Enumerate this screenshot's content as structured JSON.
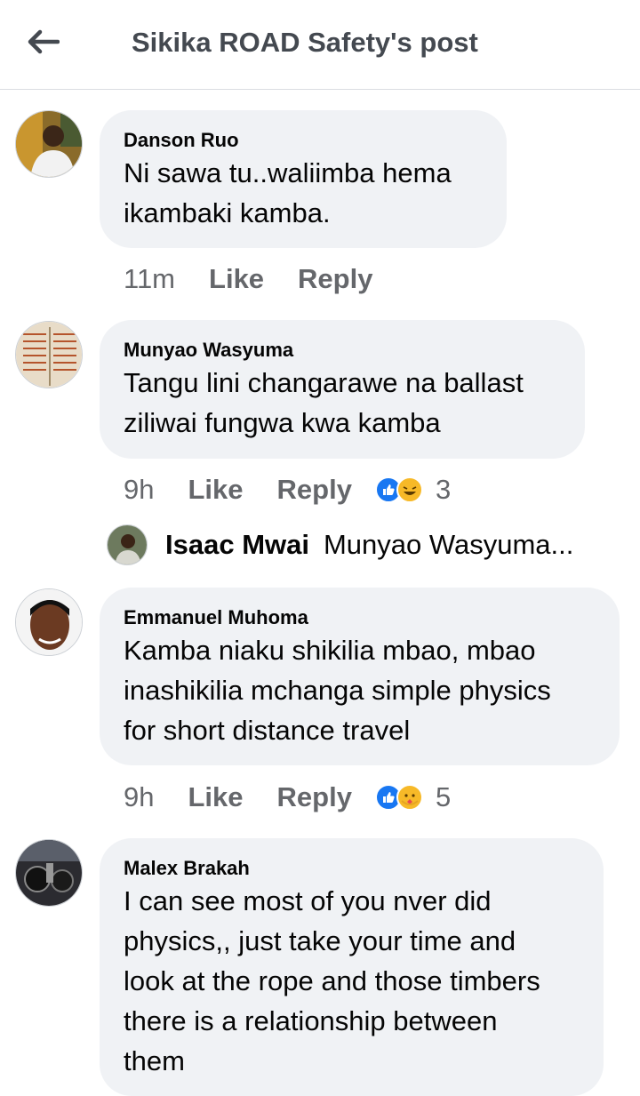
{
  "header": {
    "title": "Sikika ROAD Safety's post",
    "back_icon": "arrow-left-icon"
  },
  "comments": [
    {
      "author": "Danson Ruo",
      "lines": [
        "Ni sawa tu..waliimba hema",
        "ikambaki kamba."
      ],
      "time": "11m",
      "like": "Like",
      "reply": "Reply",
      "reaction_count": ""
    },
    {
      "author": "Munyao Wasyuma",
      "lines": [
        "Tangu lini changarawe na ballast",
        "ziliwai fungwa kwa kamba"
      ],
      "time": "9h",
      "like": "Like",
      "reply": "Reply",
      "reaction_count": "3",
      "reactions": [
        "like-reaction-icon",
        "laugh-reaction-icon"
      ]
    },
    {
      "author": "Emmanuel Muhoma",
      "lines": [
        "Kamba niaku shikilia mbao, mbao",
        "inashikilia mchanga simple physics",
        "for short distance travel"
      ],
      "time": "9h",
      "like": "Like",
      "reply": "Reply",
      "reaction_count": "5",
      "reactions": [
        "like-reaction-icon",
        "care-reaction-icon"
      ]
    },
    {
      "author": "Malex Brakah",
      "lines": [
        "I can see most of you nver did",
        "physics,, just take your time and",
        "look at the rope and those timbers",
        "there is a relationship between",
        "them"
      ]
    }
  ],
  "reply_preview": {
    "author": "Isaac Mwai",
    "text": "Munyao Wasyuma..."
  },
  "colors": {
    "bubble": "#f0f2f5",
    "meta": "#65676b",
    "like_blue": "#1877f2",
    "haha_yellow": "#f7b928"
  }
}
